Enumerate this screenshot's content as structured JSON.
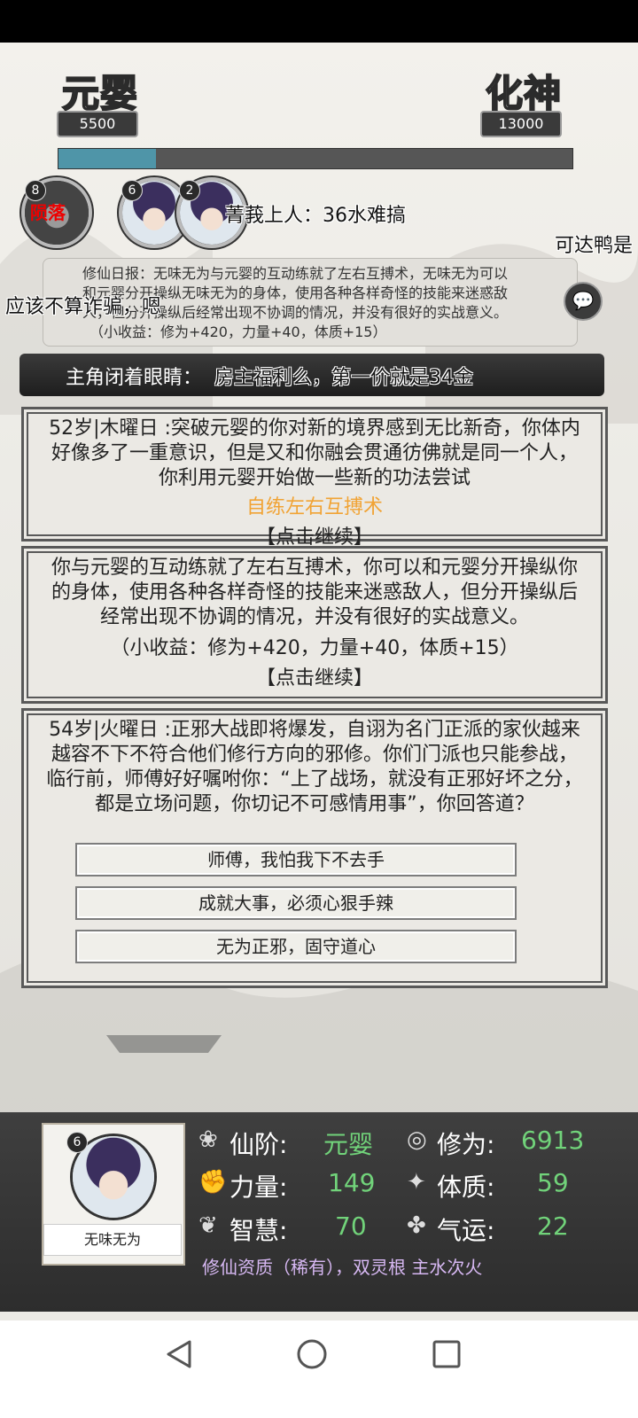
{
  "realms": {
    "current": {
      "name": "元婴",
      "value": "5500"
    },
    "next": {
      "name": "化神",
      "value": "13000"
    },
    "progress": 0.19
  },
  "avatars": [
    {
      "badge": "8",
      "tag": "陨落"
    },
    {
      "badge": "6"
    },
    {
      "badge": "2"
    }
  ],
  "danmaku": [
    "菁莪上人：36水难搞",
    "可达鸭是",
    "应该不算诈骗，嗯",
    "房主福利么，第一价就是34金"
  ],
  "daily_report": {
    "line1": "修仙日报：无味无为与元婴的互动练就了左右互搏术，无味无为可以",
    "line2": "和元婴分开操纵无味无为的身体，使用各种各样奇怪的技能来迷惑敌",
    "line3": "人，但分开操纵后经常出现不协调的情况，并没有很好的实战意义。",
    "line4": "（小收益：修为+420，力量+40，体质+15）"
  },
  "banner": {
    "text": "主角闭着眼睛："
  },
  "cards": [
    {
      "text": "52岁|木曜日 :突破元婴的你对新的境界感到无比新奇，你体内好像多了一重意识，但是又和你融会贯通彷佛就是同一个人，你利用元婴开始做一些新的功法尝试",
      "highlight": "自练左右互搏术",
      "continue": "【点击继续】"
    },
    {
      "text": "你与元婴的互动练就了左右互搏术，你可以和元婴分开操纵你的身体，使用各种各样奇怪的技能来迷惑敌人，但分开操纵后经常出现不协调的情况，并没有很好的实战意义。",
      "gain": "（小收益：修为+420，力量+40，体质+15）",
      "continue": "【点击继续】"
    },
    {
      "text": "54岁|火曜日 :正邪大战即将爆发，自诩为名门正派的家伙越来越容不下不符合他们修行方向的邪修。你们门派也只能参战，临行前，师傅好好嘱咐你：“上了战场，就没有正邪好坏之分，都是立场问题，你切记不可感情用事”，你回答道？",
      "options": [
        "师傅，我怕我下不去手",
        "成就大事，必须心狠手辣",
        "无为正邪，固守道心"
      ]
    }
  ],
  "character": {
    "badge": "6",
    "name": "无味无为",
    "stats": {
      "realm_label": "仙阶:",
      "realm": "元婴",
      "cultivation_label": "修为:",
      "cultivation": "6913",
      "strength_label": "力量:",
      "strength": "149",
      "constitution_label": "体质:",
      "constitution": "59",
      "wisdom_label": "智慧:",
      "wisdom": "70",
      "luck_label": "气运:",
      "luck": "22"
    },
    "aptitude": "修仙资质（稀有），双灵根 主水次火"
  },
  "colors": {
    "progress_fill": "#4f95a8",
    "stat_value": "#71d37a",
    "highlight": "#f1a334",
    "aptitude": "#d7b8f3"
  },
  "icons": [
    "chat-bubble-icon",
    "realm-icon",
    "cultivation-icon",
    "strength-icon",
    "constitution-icon",
    "wisdom-icon",
    "luck-icon",
    "back-icon",
    "home-icon",
    "recents-icon"
  ]
}
